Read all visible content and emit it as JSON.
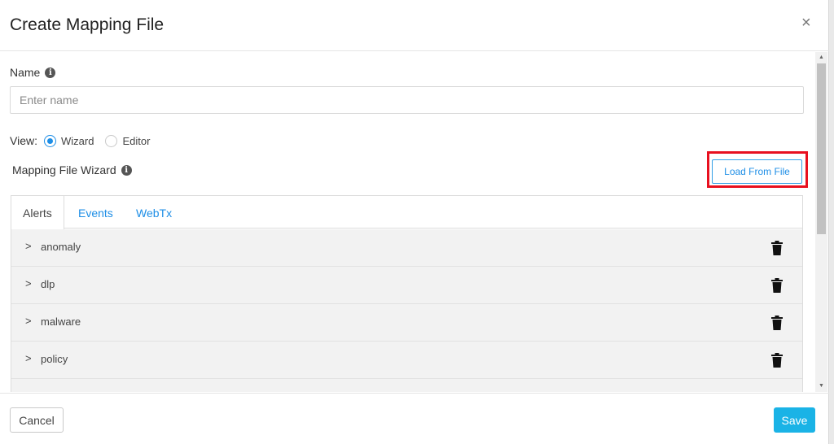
{
  "modal": {
    "title": "Create Mapping File",
    "close_label": "×"
  },
  "name_field": {
    "label": "Name",
    "placeholder": "Enter name",
    "value": ""
  },
  "view": {
    "label": "View:",
    "options": [
      {
        "label": "Wizard",
        "checked": true
      },
      {
        "label": "Editor",
        "checked": false
      }
    ]
  },
  "wizard": {
    "label": "Mapping File Wizard",
    "load_button": "Load From File"
  },
  "tabs": [
    {
      "label": "Alerts",
      "active": true
    },
    {
      "label": "Events",
      "active": false
    },
    {
      "label": "WebTx",
      "active": false
    }
  ],
  "alert_rows": [
    {
      "label": "anomaly"
    },
    {
      "label": "dlp"
    },
    {
      "label": "malware"
    },
    {
      "label": "policy"
    }
  ],
  "footer": {
    "cancel_label": "Cancel",
    "save_label": "Save"
  },
  "icons": {
    "info": "info-icon",
    "chevron": "chevron-right-icon",
    "delete": "trash-icon",
    "close": "close-icon"
  },
  "colors": {
    "accent": "#1e8ee6",
    "save_button": "#1ab3e6",
    "highlight_box": "#e8101f"
  }
}
